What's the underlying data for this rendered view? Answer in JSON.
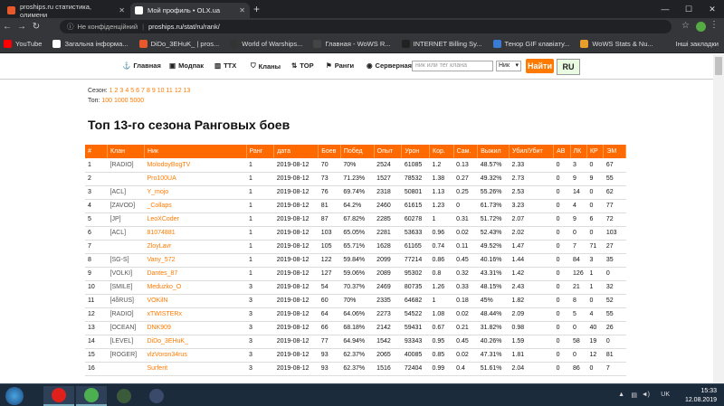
{
  "browser": {
    "tabs": [
      {
        "label": "proships.ru статистика, олимени",
        "color": "#e8582a",
        "active": false
      },
      {
        "label": "Мой профиль • OLX.ua",
        "color": "#ffffff",
        "active": true
      }
    ],
    "insecure_label": "Не конфіденційний",
    "url": "proships.ru/stat/ru/rank/",
    "bookmarks": [
      {
        "label": "YouTube",
        "color": "#ff0000"
      },
      {
        "label": "Загальна інформа...",
        "color": "#ffffff"
      },
      {
        "label": "DiDo_3EHuK_ | pros...",
        "color": "#e8582a"
      },
      {
        "label": "World of Warships...",
        "color": "#333333"
      },
      {
        "label": "Главная - WoWS R...",
        "color": "#444444"
      },
      {
        "label": "INTERNET Billing Sy...",
        "color": "#222222"
      },
      {
        "label": "Тенор GIF клавіату...",
        "color": "#3a7bd5"
      },
      {
        "label": "WoWS Stats & Nu...",
        "color": "#e8a02a"
      }
    ],
    "other_bookmarks": "Інші закладки"
  },
  "site": {
    "nav": [
      {
        "label": "Главная",
        "icon": "anchor-icon",
        "glyph": "⚓"
      },
      {
        "label": "Модпак",
        "icon": "box-icon",
        "glyph": "▣"
      },
      {
        "label": "ТТХ",
        "icon": "chart-icon",
        "glyph": "▥"
      },
      {
        "label": "Кланы",
        "icon": "shield-icon",
        "glyph": "⛉"
      },
      {
        "label": "TOP",
        "icon": "top-icon",
        "glyph": "⇅"
      },
      {
        "label": "Ранги",
        "icon": "rank-icon",
        "glyph": "⚑"
      },
      {
        "label": "Серверная",
        "icon": "globe-icon",
        "glyph": "◉"
      }
    ],
    "search_placeholder": "ник или тег клана",
    "search_select": "Ник",
    "find_button": "Найти",
    "lang_button": "RU",
    "season_label": "Сезон:",
    "seasons": [
      "1",
      "2",
      "3",
      "4",
      "5",
      "6",
      "7",
      "8",
      "9",
      "10",
      "11",
      "12",
      "13"
    ],
    "top_label": "Топ:",
    "tops": [
      "100",
      "1000",
      "5000"
    ],
    "title": "Топ 13-го сезона Ранговых боев"
  },
  "table": {
    "headers": [
      "#",
      "Клан",
      "Ник",
      "Ранг",
      "дата",
      "Боев",
      "Побед",
      "Опыт",
      "Урон",
      "Кор.",
      "Сам.",
      "Выжил",
      "Убил/Убит",
      "АВ",
      "ЛК",
      "КР",
      "ЭМ"
    ],
    "rows": [
      [
        "1",
        "[RADIO]",
        "MolodoyBogTV",
        "1",
        "2019-08-12",
        "70",
        "70%",
        "2524",
        "61085",
        "1.2",
        "0.13",
        "48.57%",
        "2.33",
        "0",
        "3",
        "0",
        "67"
      ],
      [
        "2",
        "",
        "Pro100UA",
        "1",
        "2019-08-12",
        "73",
        "71.23%",
        "1527",
        "78532",
        "1.38",
        "0.27",
        "49.32%",
        "2.73",
        "0",
        "9",
        "9",
        "55"
      ],
      [
        "3",
        "[ACL]",
        "Y_mojo",
        "1",
        "2019-08-12",
        "76",
        "69.74%",
        "2318",
        "50801",
        "1.13",
        "0.25",
        "55.26%",
        "2.53",
        "0",
        "14",
        "0",
        "62"
      ],
      [
        "4",
        "[ZAVOD]",
        "_Collaps",
        "1",
        "2019-08-12",
        "81",
        "64.2%",
        "2460",
        "61615",
        "1.23",
        "0",
        "61.73%",
        "3.23",
        "0",
        "4",
        "0",
        "77"
      ],
      [
        "5",
        "[JP]",
        "LeoXCoder",
        "1",
        "2019-08-12",
        "87",
        "67.82%",
        "2285",
        "60278",
        "1",
        "0.31",
        "51.72%",
        "2.07",
        "0",
        "9",
        "6",
        "72"
      ],
      [
        "6",
        "[ACL]",
        "81074881",
        "1",
        "2019-08-12",
        "103",
        "65.05%",
        "2281",
        "53633",
        "0.96",
        "0.02",
        "52.43%",
        "2.02",
        "0",
        "0",
        "0",
        "103"
      ],
      [
        "7",
        "",
        "ZloyLavr",
        "1",
        "2019-08-12",
        "105",
        "65.71%",
        "1628",
        "61165",
        "0.74",
        "0.11",
        "49.52%",
        "1.47",
        "0",
        "7",
        "71",
        "27"
      ],
      [
        "8",
        "[SG-S]",
        "Vany_572",
        "1",
        "2019-08-12",
        "122",
        "59.84%",
        "2099",
        "77214",
        "0.86",
        "0.45",
        "40.16%",
        "1.44",
        "0",
        "84",
        "3",
        "35"
      ],
      [
        "9",
        "[VOLKI]",
        "Dantes_87",
        "1",
        "2019-08-12",
        "127",
        "59.06%",
        "2089",
        "95302",
        "0.8",
        "0.32",
        "43.31%",
        "1.42",
        "0",
        "126",
        "1",
        "0"
      ],
      [
        "10",
        "[SMILE]",
        "Meduzko_O",
        "3",
        "2019-08-12",
        "54",
        "70.37%",
        "2469",
        "80735",
        "1.26",
        "0.33",
        "48.15%",
        "2.43",
        "0",
        "21",
        "1",
        "32"
      ],
      [
        "11",
        "[4δRUS]",
        "VOKilN",
        "3",
        "2019-08-12",
        "60",
        "70%",
        "2335",
        "64682",
        "1",
        "0.18",
        "45%",
        "1.82",
        "0",
        "8",
        "0",
        "52"
      ],
      [
        "12",
        "[RADIO]",
        "xTWISTERx",
        "3",
        "2019-08-12",
        "64",
        "64.06%",
        "2273",
        "54522",
        "1.08",
        "0.02",
        "48.44%",
        "2.09",
        "0",
        "5",
        "4",
        "55"
      ],
      [
        "13",
        "[OCEAN]",
        "DNK909",
        "3",
        "2019-08-12",
        "66",
        "68.18%",
        "2142",
        "59431",
        "0.67",
        "0.21",
        "31.82%",
        "0.98",
        "0",
        "0",
        "40",
        "26"
      ],
      [
        "14",
        "[LEVEL]",
        "DiDo_3EHuK_",
        "3",
        "2019-08-12",
        "77",
        "64.94%",
        "1542",
        "93343",
        "0.95",
        "0.45",
        "40.26%",
        "1.59",
        "0",
        "58",
        "19",
        "0"
      ],
      [
        "15",
        "[ROGER]",
        "vlzVoron34rus",
        "3",
        "2019-08-12",
        "93",
        "62.37%",
        "2065",
        "40085",
        "0.85",
        "0.02",
        "47.31%",
        "1.81",
        "0",
        "0",
        "12",
        "81"
      ],
      [
        "16",
        "",
        "Surferit",
        "3",
        "2019-08-12",
        "93",
        "62.37%",
        "1516",
        "72404",
        "0.99",
        "0.4",
        "51.61%",
        "2.04",
        "0",
        "86",
        "0",
        "7"
      ]
    ]
  },
  "taskbar": {
    "lang": "UK",
    "time": "15:33",
    "date": "12.08.2019",
    "apps": [
      {
        "name": "opera-icon",
        "color": "#e0201a"
      },
      {
        "name": "chrome-icon",
        "color": "#4caf50"
      },
      {
        "name": "clan-app-icon",
        "color": "#3a5a3a"
      },
      {
        "name": "wows-icon",
        "color": "#3a4a6a"
      }
    ]
  }
}
